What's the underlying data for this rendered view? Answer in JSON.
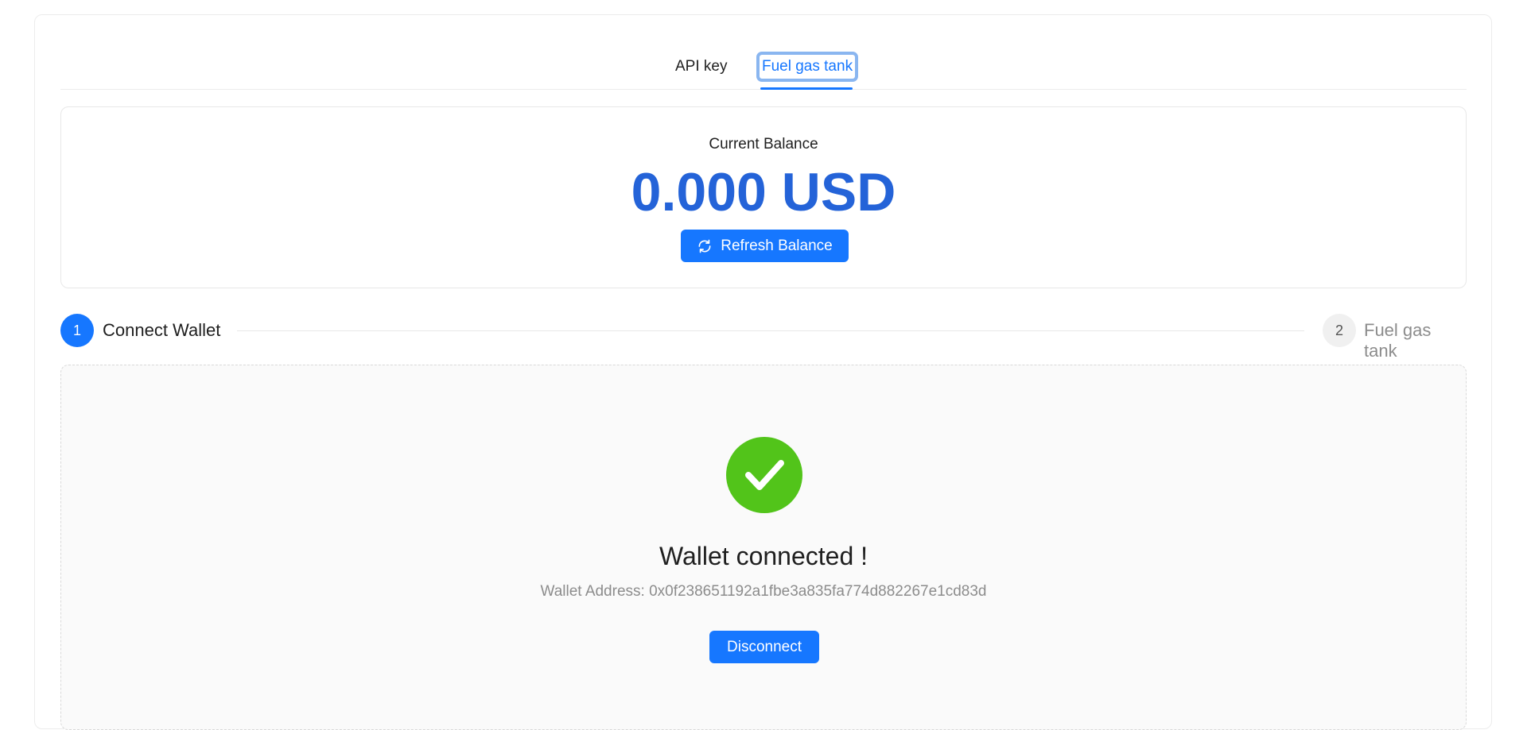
{
  "tabs": {
    "api_key_label": "API key",
    "fuel_gas_tank_label": "Fuel gas tank",
    "active": "Fuel gas tank"
  },
  "balance": {
    "label": "Current Balance",
    "value": "0.000 USD",
    "refresh_label": "Refresh Balance",
    "refresh_icon": "sync-icon"
  },
  "steps": [
    {
      "number": "1",
      "title": "Connect Wallet",
      "status": "active"
    },
    {
      "number": "2",
      "title": "Fuel gas tank",
      "status": "waiting"
    }
  ],
  "connect_result": {
    "icon": "check-circle-icon",
    "title": "Wallet connected !",
    "address_text": "Wallet Address: 0x0f238651192a1fbe3a835fa774d882267e1cd83d",
    "disconnect_label": "Disconnect"
  },
  "colors": {
    "primary": "#1677ff",
    "balance_text": "#2463d8",
    "success": "#52c41a"
  }
}
